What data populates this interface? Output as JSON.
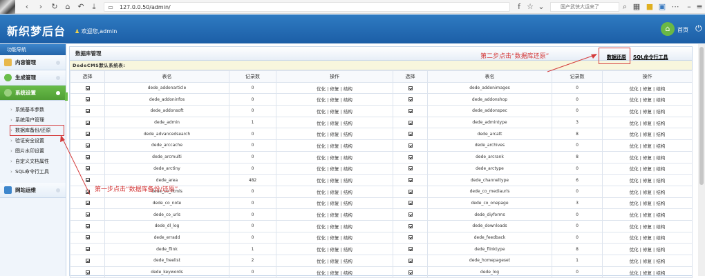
{
  "browser": {
    "url": "127.0.0.50/admin/",
    "right_search": "国产武侠大运来了"
  },
  "header": {
    "logo": "新织梦后台",
    "welcome": "欢迎您,admin",
    "home": "首页"
  },
  "sidebar": {
    "title": "功能导航",
    "sections": [
      "内容管理",
      "生成管理",
      "系统设置",
      "网站运维"
    ],
    "sub_items": [
      "系统基本参数",
      "系统用户管理",
      "数据库备份/还原",
      "验证安全设置",
      "图片水印设置",
      "自定义文档属性",
      "SQL命令行工具"
    ]
  },
  "main": {
    "title": "数据库管理",
    "restore_link": "数据还原",
    "sql_link": "SQL命令行工具",
    "db_title": "DedeCMS默认系统表:",
    "columns": [
      "选择",
      "表名",
      "记录数",
      "操作",
      "选择",
      "表名",
      "记录数",
      "操作"
    ],
    "ops": "优化 | 修复 | 结构",
    "rows": [
      [
        "dede_addonarticle",
        "0",
        "dede_addonimages",
        "0"
      ],
      [
        "dede_addoninfos",
        "0",
        "dede_addonshop",
        "0"
      ],
      [
        "dede_addonsoft",
        "0",
        "dede_addonspec",
        "0"
      ],
      [
        "dede_admin",
        "1",
        "dede_admintype",
        "3"
      ],
      [
        "dede_advancedsearch",
        "0",
        "dede_arcatt",
        "8"
      ],
      [
        "dede_arccache",
        "0",
        "dede_archives",
        "0"
      ],
      [
        "dede_arcmulti",
        "0",
        "dede_arcrank",
        "8"
      ],
      [
        "dede_arctiny",
        "0",
        "dede_arctype",
        "0"
      ],
      [
        "dede_area",
        "482",
        "dede_channeltype",
        "6"
      ],
      [
        "dede_co_htmls",
        "0",
        "dede_co_mediaurls",
        "0"
      ],
      [
        "dede_co_note",
        "0",
        "dede_co_onepage",
        "3"
      ],
      [
        "dede_co_urls",
        "0",
        "dede_diyforms",
        "0"
      ],
      [
        "dede_dl_log",
        "0",
        "dede_downloads",
        "0"
      ],
      [
        "dede_erradd",
        "0",
        "dede_feedback",
        "0"
      ],
      [
        "dede_flink",
        "1",
        "dede_flinktype",
        "8"
      ],
      [
        "dede_freelist",
        "2",
        "dede_homepageset",
        "1"
      ],
      [
        "dede_keywords",
        "0",
        "dede_log",
        "0"
      ]
    ]
  },
  "annotations": {
    "step1": "第一步点击“数据库备份/还原”",
    "step2": "第二步点击“数据库还原”"
  }
}
